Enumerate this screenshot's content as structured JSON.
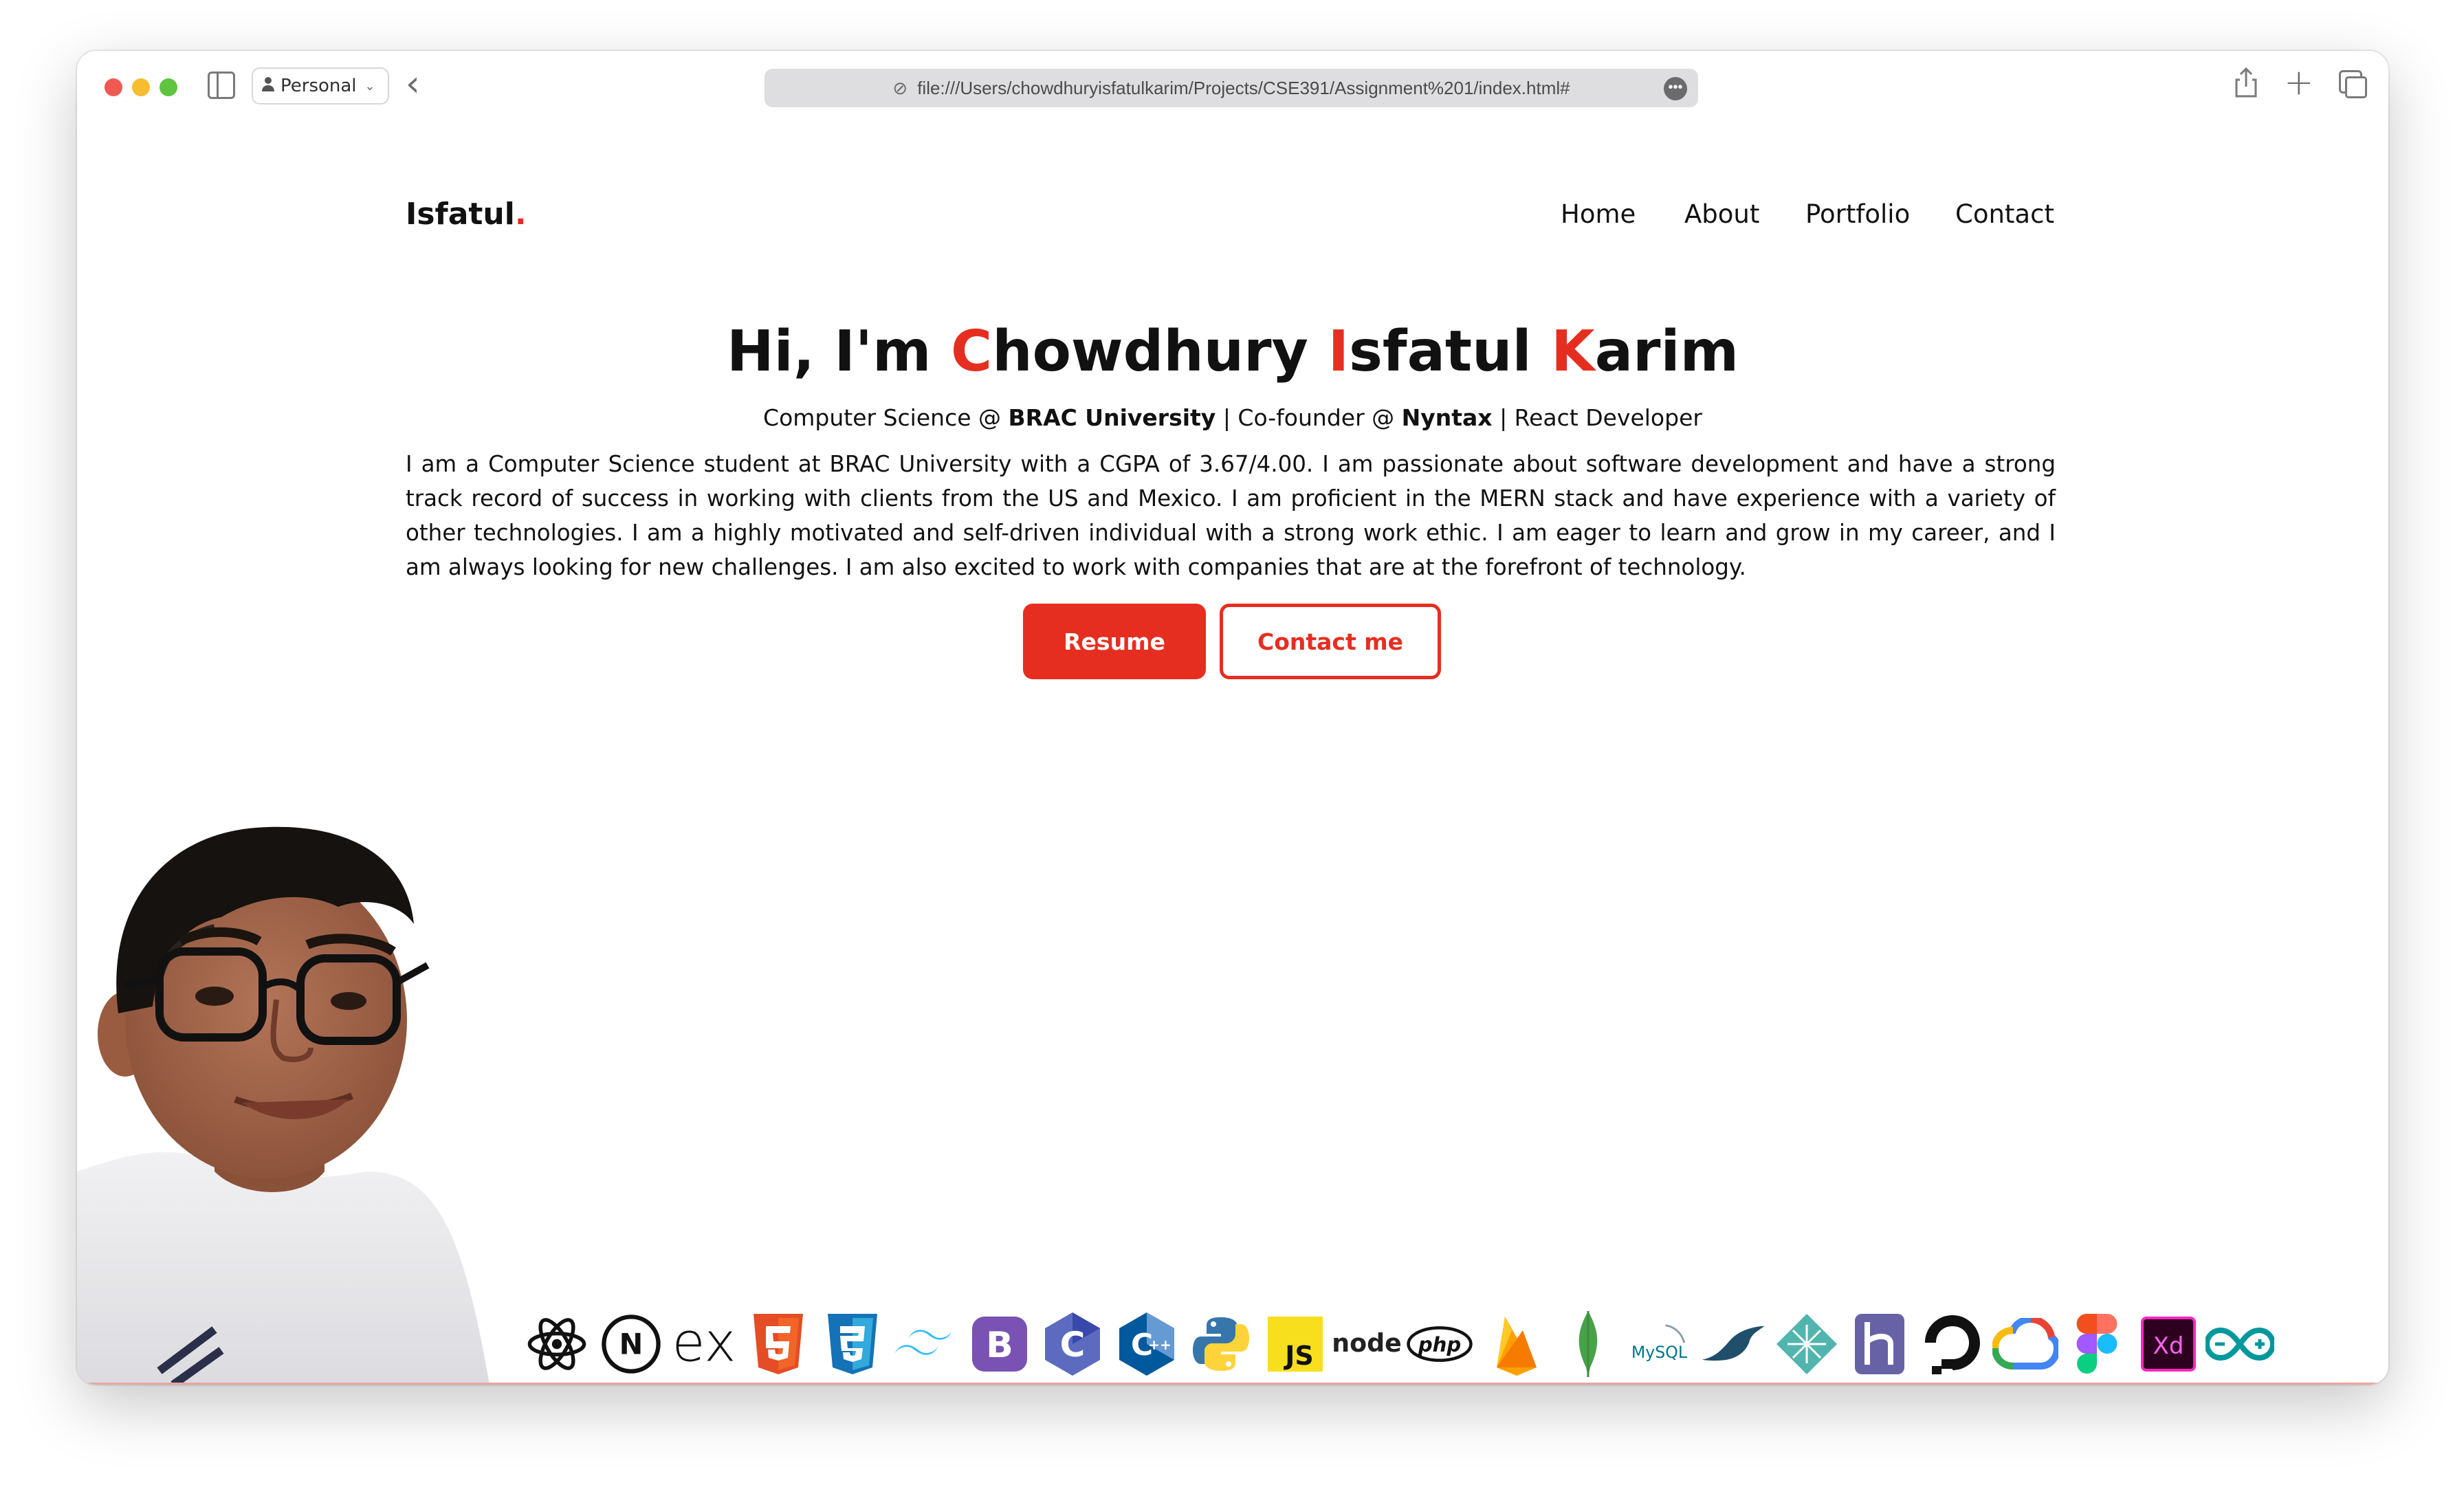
{
  "browser": {
    "profile_label": "Personal",
    "url": "file:///Users/chowdhuryisfatulkarim/Projects/CSE391/Assignment%201/index.html#"
  },
  "site": {
    "logo_text": "Isfatul",
    "logo_dot": ".",
    "nav": [
      "Home",
      "About",
      "Portfolio",
      "Contact"
    ]
  },
  "hero": {
    "greeting": "Hi, I'm ",
    "name_parts": [
      {
        "initial": "C",
        "rest": "howdhury"
      },
      {
        "initial": "I",
        "rest": "sfatul"
      },
      {
        "initial": "K",
        "rest": "arim"
      }
    ],
    "subtitle": {
      "p1": "Computer Science @ ",
      "b1": "BRAC University",
      "p2": " | Co-founder @ ",
      "b2": "Nyntax",
      "p3": " | React Developer"
    },
    "bio": "I am a Computer Science student at BRAC University with a CGPA of 3.67/4.00. I am passionate about software development and have a strong track record of success in working with clients from the US and Mexico. I am proficient in the MERN stack and have experience with a variety of other technologies. I am a highly motivated and self-driven individual with a strong work ethic. I am eager to learn and grow in my career, and I am always looking for new challenges. I am also excited to work with companies that are at the forefront of technology.",
    "resume_button": "Resume",
    "contact_button": "Contact me"
  },
  "tech_icons": [
    "react-icon",
    "nextjs-icon",
    "express-icon",
    "html5-icon",
    "css3-icon",
    "tailwind-icon",
    "bootstrap-icon",
    "c-icon",
    "cpp-icon",
    "python-icon",
    "javascript-icon",
    "nodejs-icon",
    "php-icon",
    "firebase-icon",
    "mongodb-icon",
    "mysql-icon",
    "mariadb-icon",
    "netlify-icon",
    "heroku-icon",
    "digitalocean-icon",
    "google-cloud-icon",
    "figma-icon",
    "adobe-xd-icon",
    "arduino-icon"
  ],
  "tech_text": {
    "express": "ex",
    "js": "JS",
    "node": "node",
    "php": "php",
    "mysql": "MySQL",
    "xd": "Xd",
    "next": "N"
  },
  "colors": {
    "accent": "#e62e20",
    "text": "#111111"
  }
}
